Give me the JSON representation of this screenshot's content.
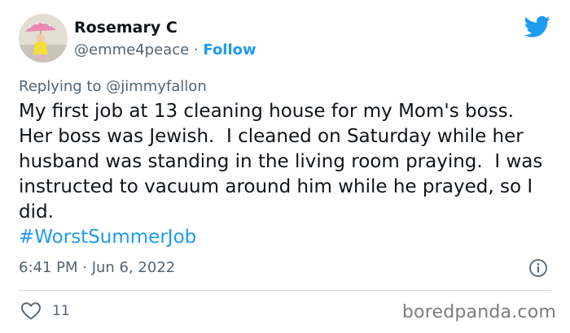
{
  "author": {
    "name": "Rosemary C",
    "handle": "@emme4peace",
    "separator": "·",
    "follow_label": "Follow",
    "avatar_icon": "avatar"
  },
  "platform_icon": "twitter-bird-icon",
  "reply": {
    "prefix": "Replying to",
    "handle": "@jimmyfallon"
  },
  "tweet": {
    "text": "My first job at 13 cleaning house for my Mom's boss.  Her boss was Jewish.  I cleaned on Saturday while her husband was standing in the living room praying.  I was instructed to vacuum around him while he prayed, so I did.",
    "hashtag": "#WorstSummerJob",
    "timestamp": "6:41 PM · Jun 6, 2022"
  },
  "actions": {
    "like_count": "11"
  },
  "watermark": "boredpanda.com",
  "colors": {
    "accent": "#1d9bf0",
    "text": "#0f1419",
    "secondary": "#536471",
    "divider": "#cfd9de"
  }
}
